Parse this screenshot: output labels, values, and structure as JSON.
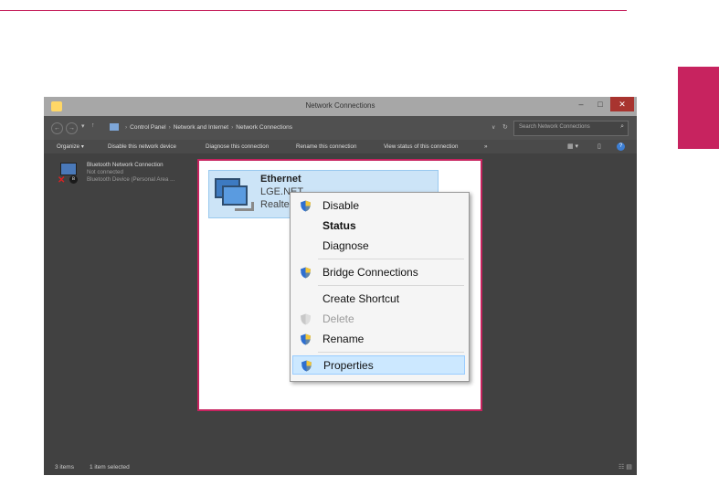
{
  "window": {
    "title": "Network Connections",
    "minimize_icon": "minimize-icon",
    "maximize_icon": "maximize-icon",
    "close_icon": "close-icon",
    "minimize_glyph": "–",
    "maximize_glyph": "□",
    "close_glyph": "✕"
  },
  "address_bar": {
    "back_glyph": "←",
    "forward_glyph": "→",
    "history_glyph": "▾",
    "up_glyph": "↑",
    "breadcrumb": [
      "Control Panel",
      "Network and Internet",
      "Network Connections"
    ],
    "separator": "›",
    "dropdown_glyph": "∨",
    "refresh_glyph": "↻",
    "search_placeholder": "Search Network Connections",
    "search_glyph": "⌕"
  },
  "command_bar": {
    "items": [
      "Organize ▾",
      "Disable this network device",
      "Diagnose this connection",
      "Rename this connection",
      "View status of this connection",
      "»"
    ],
    "view_glyph": "▦ ▾",
    "pane_glyph": "▯",
    "help_glyph": "?"
  },
  "connections": [
    {
      "name": "Bluetooth Network Connection",
      "status": "Not connected",
      "device": "Bluetooth Device (Personal Area ...",
      "icon": "network-disconnected-icon",
      "x_glyph": "✕",
      "bt_glyph": "ʙ"
    },
    {
      "name": "Ethernet",
      "status": "LGE.NET",
      "device": "Realte",
      "icon": "ethernet-adapter-icon",
      "selected": true
    }
  ],
  "context_menu": {
    "items": [
      {
        "label": "Disable",
        "shield": true
      },
      {
        "label": "Status",
        "bold": true
      },
      {
        "label": "Diagnose"
      },
      {
        "label": "Bridge Connections",
        "shield": true
      },
      {
        "label": "Create Shortcut"
      },
      {
        "label": "Delete",
        "disabled": true,
        "shield": true
      },
      {
        "label": "Rename",
        "shield": true
      },
      {
        "label": "Properties",
        "shield": true,
        "selected": true
      }
    ]
  },
  "status_bar": {
    "item_count": "3 items",
    "selection": "1 item selected",
    "view_glyph": "☷ ▤"
  },
  "colors": {
    "accent": "#c7235f",
    "window_dark": "#414141",
    "selection": "#cce4f7",
    "menu_highlight": "#cce8ff"
  }
}
